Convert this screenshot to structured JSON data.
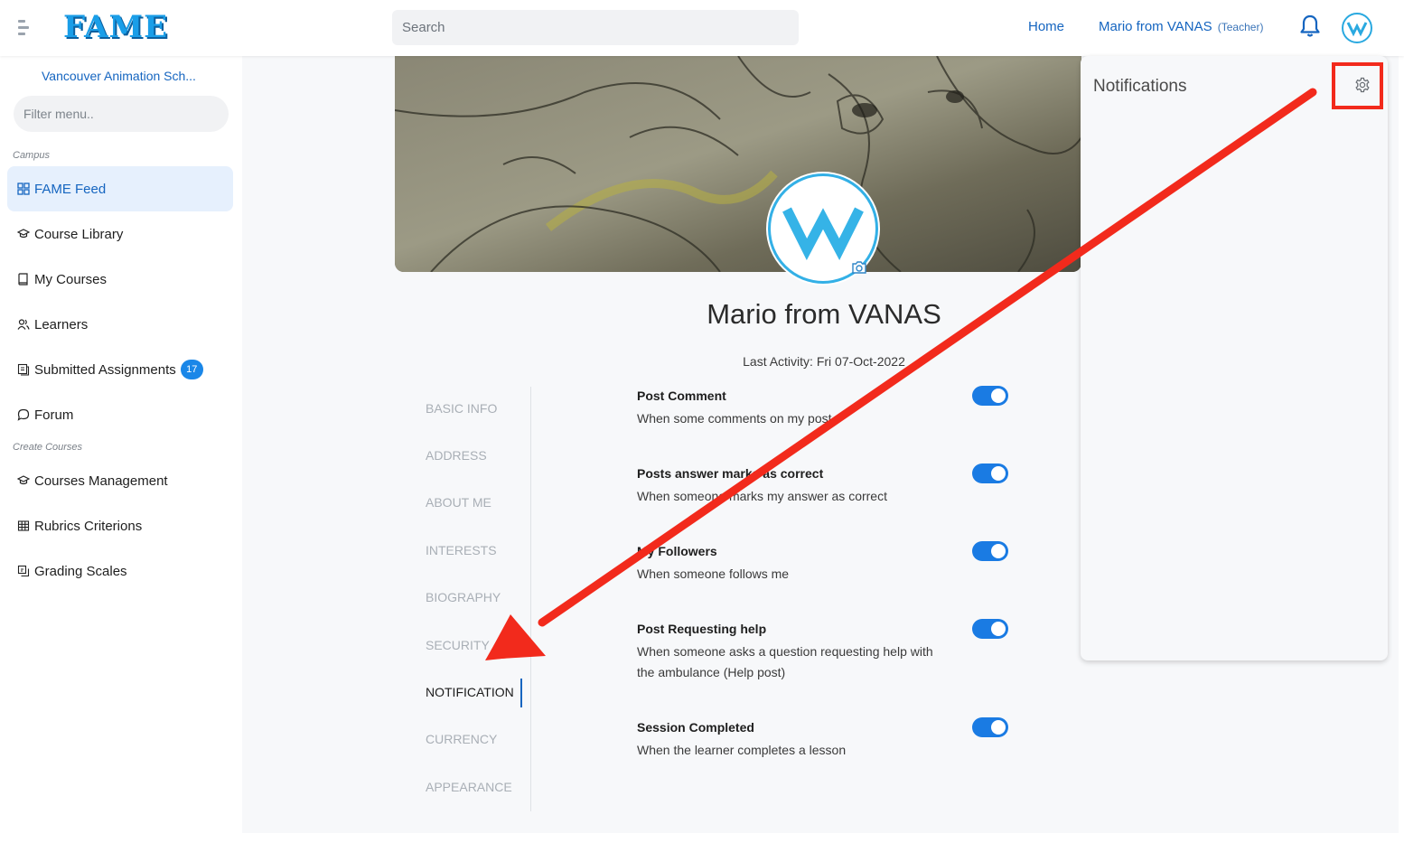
{
  "topbar": {
    "logo": "FAME",
    "search_placeholder": "Search",
    "home_label": "Home",
    "user_name": "Mario from VANAS",
    "user_role": "(Teacher)"
  },
  "sidebar": {
    "school": "Vancouver Animation Sch...",
    "filter_placeholder": "Filter menu..",
    "section_campus": "Campus",
    "section_create": "Create Courses",
    "items": [
      {
        "label": "FAME Feed",
        "icon": "grid-icon"
      },
      {
        "label": "Course Library",
        "icon": "graduation-cap-icon"
      },
      {
        "label": "My Courses",
        "icon": "book-icon"
      },
      {
        "label": "Learners",
        "icon": "users-icon"
      },
      {
        "label": "Submitted Assignments",
        "icon": "assignment-icon",
        "badge": "17"
      },
      {
        "label": "Forum",
        "icon": "chat-icon"
      },
      {
        "label": "Courses Management",
        "icon": "graduation-cap-icon"
      },
      {
        "label": "Rubrics Criterions",
        "icon": "table-icon"
      },
      {
        "label": "Grading Scales",
        "icon": "scale-icon"
      }
    ]
  },
  "profile": {
    "name": "Mario from VANAS",
    "last_activity": "Last Activity: Fri 07-Oct-2022"
  },
  "tabs": [
    "BASIC INFO",
    "ADDRESS",
    "ABOUT ME",
    "INTERESTS",
    "BIOGRAPHY",
    "SECURITY",
    "NOTIFICATION",
    "CURRENCY",
    "APPEARANCE"
  ],
  "active_tab": "NOTIFICATION",
  "notifications": [
    {
      "title": "Post Comment",
      "desc": "When some comments on my post",
      "enabled": true
    },
    {
      "title": "Posts answer marks as correct",
      "desc": "When someone marks my answer as correct",
      "enabled": true
    },
    {
      "title": "My Followers",
      "desc": "When someone follows me",
      "enabled": true
    },
    {
      "title": "Post Requesting help",
      "desc": "When someone asks a question requesting help with the ambulance (Help post)",
      "enabled": true
    },
    {
      "title": "Session Completed",
      "desc": "When the learner completes a lesson",
      "enabled": true
    }
  ],
  "notifications_panel": {
    "title": "Notifications"
  },
  "colors": {
    "accent": "#1565c0",
    "toggle": "#1a7be3",
    "annotation": "#f22a1c"
  }
}
